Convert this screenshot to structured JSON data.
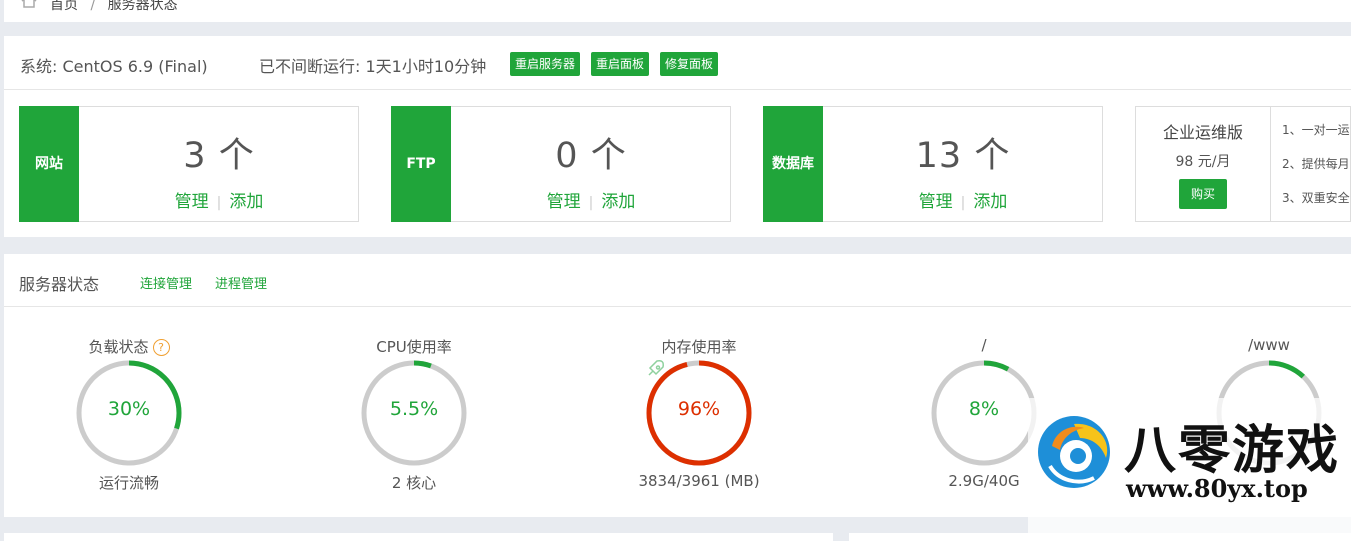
{
  "breadcrumb": {
    "home": "首页",
    "sep": "/",
    "current": "服务器状态"
  },
  "system": {
    "os": "系统: CentOS 6.9 (Final)",
    "uptime": "已不间断运行: 1天1小时10分钟",
    "buttons": [
      "重启服务器",
      "重启面板",
      "修复面板"
    ]
  },
  "cards": [
    {
      "tag": "网站",
      "count": "3 个",
      "manage": "管理",
      "add": "添加"
    },
    {
      "tag": "FTP",
      "count": "0 个",
      "manage": "管理",
      "add": "添加"
    },
    {
      "tag": "数据库",
      "count": "13 个",
      "manage": "管理",
      "add": "添加"
    }
  ],
  "enterprise": {
    "name": "企业运维版",
    "price": "98 元/月",
    "buy": "购买",
    "features": [
      "1、一对一运",
      "2、提供每月",
      "3、双重安全"
    ]
  },
  "status": {
    "title": "服务器状态",
    "links": [
      "连接管理",
      "进程管理"
    ],
    "gauges": [
      {
        "title": "负载状态",
        "percent": 30,
        "label": "30%",
        "sub": "运行流畅",
        "color": "#20a53a"
      },
      {
        "title": "CPU使用率",
        "percent": 5.5,
        "label": "5.5%",
        "sub": "2 核心",
        "color": "#20a53a"
      },
      {
        "title": "内存使用率",
        "percent": 96,
        "label": "96%",
        "sub": "3834/3961 (MB)",
        "color": "#dd2f00"
      },
      {
        "title": "/",
        "percent": 8,
        "label": "8%",
        "sub": "2.9G/40G",
        "color": "#20a53a"
      },
      {
        "title": "/www",
        "percent": 12,
        "label": "",
        "sub": "",
        "color": "#20a53a"
      }
    ]
  },
  "watermark": {
    "title": "八零游戏",
    "url": "www.80yx.top"
  },
  "colors": {
    "accent": "#20a53a",
    "danger": "#dd2f00",
    "track": "#cccccc"
  }
}
